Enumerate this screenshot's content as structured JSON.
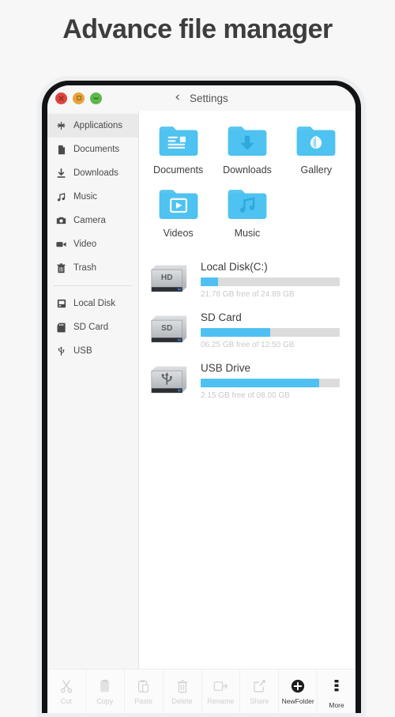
{
  "page": {
    "title": "Advance file manager"
  },
  "window_controls": [
    {
      "name": "close",
      "glyph": "×",
      "color": "#e0443e"
    },
    {
      "name": "maximize",
      "glyph": "■",
      "color": "#e9a33b"
    },
    {
      "name": "minimize",
      "glyph": "−",
      "color": "#5bb84b"
    }
  ],
  "navbar": {
    "back_icon": "chevron-left-icon",
    "back_glyph": "‹",
    "title": "Settings"
  },
  "sidebar": {
    "group1": [
      {
        "label": "Applications",
        "icon": "applications-icon",
        "selected": true
      },
      {
        "label": "Documents",
        "icon": "document-icon",
        "selected": false
      },
      {
        "label": "Downloads",
        "icon": "download-icon",
        "selected": false
      },
      {
        "label": "Music",
        "icon": "music-note-icon",
        "selected": false
      },
      {
        "label": "Camera",
        "icon": "camera-icon",
        "selected": false
      },
      {
        "label": "Video",
        "icon": "video-camera-icon",
        "selected": false
      },
      {
        "label": "Trash",
        "icon": "trash-icon",
        "selected": false
      }
    ],
    "group2": [
      {
        "label": "Local Disk",
        "icon": "hard-disk-icon",
        "selected": false
      },
      {
        "label": "SD Card",
        "icon": "sd-card-icon",
        "selected": false
      },
      {
        "label": "USB",
        "icon": "usb-icon",
        "selected": false
      }
    ]
  },
  "folders": [
    {
      "label": "Documents",
      "icon": "folder-documents-icon"
    },
    {
      "label": "Downloads",
      "icon": "folder-downloads-icon"
    },
    {
      "label": "Gallery",
      "icon": "folder-gallery-icon"
    },
    {
      "label": "Videos",
      "icon": "folder-videos-icon"
    },
    {
      "label": "Music",
      "icon": "folder-music-icon"
    }
  ],
  "storage": [
    {
      "name": "Local Disk(C:)",
      "badge": "HD",
      "icon": "hard-drive-icon",
      "usage_text": "21.78 GB free of 24.89 GB",
      "used_percent": 12.5,
      "free": "21.78 GB",
      "total": "24.89 GB"
    },
    {
      "name": "SD Card",
      "badge": "SD",
      "icon": "sd-drive-icon",
      "usage_text": "06.25 GB free of 12.50 GB",
      "used_percent": 50,
      "free": "06.25 GB",
      "total": "12.50 GB"
    },
    {
      "name": "USB Drive",
      "badge": "USB",
      "icon": "usb-drive-icon",
      "usage_text": "2.15 GB free of 08.00 GB",
      "used_percent": 85,
      "free": "2.15 GB",
      "total": "08.00 GB"
    }
  ],
  "toolbar": [
    {
      "label": "Cut",
      "icon": "scissors-icon",
      "enabled": false
    },
    {
      "label": "Copy",
      "icon": "copy-icon",
      "enabled": false
    },
    {
      "label": "Paste",
      "icon": "paste-icon",
      "enabled": false
    },
    {
      "label": "Delete",
      "icon": "trash-icon",
      "enabled": false
    },
    {
      "label": "Rename",
      "icon": "rename-icon",
      "enabled": false
    },
    {
      "label": "Share",
      "icon": "share-icon",
      "enabled": false
    },
    {
      "label": "NewFolder",
      "icon": "plus-circle-icon",
      "enabled": true
    },
    {
      "label": "More",
      "icon": "more-vertical-icon",
      "enabled": true
    }
  ],
  "colors": {
    "accent_blue": "#4fc0f2",
    "bar_track": "#dcdcdc",
    "sidebar_bg": "#f6f6f6",
    "title_text": "#3d3d3d"
  }
}
